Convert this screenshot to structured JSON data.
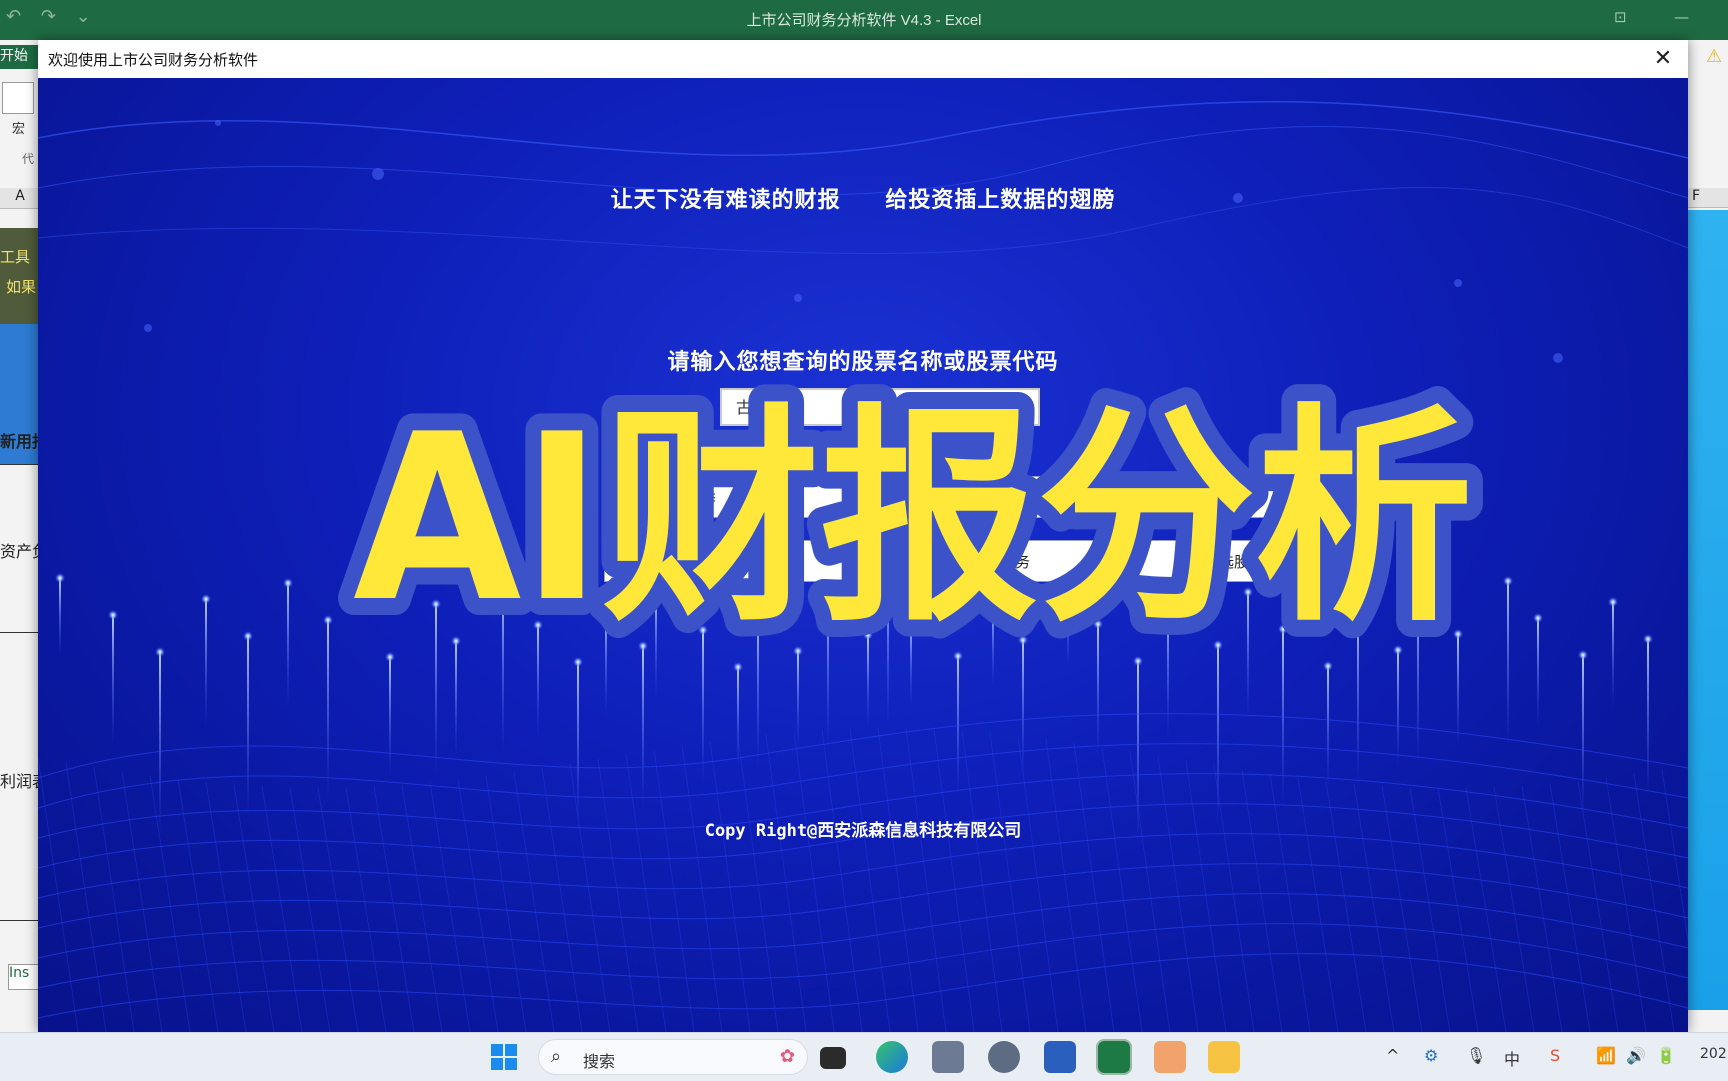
{
  "excel": {
    "window_title": "上市公司财务分析软件 V4.3 - Excel",
    "tab_start": "开始",
    "macro_label": "宏",
    "code_label": "代",
    "column_a": "A",
    "column_f": "F",
    "left_cells": [
      "工具",
      "如果",
      "新用报",
      "资产负债",
      "利润表"
    ],
    "sheet_tab": "Ins"
  },
  "dialog": {
    "title": "欢迎使用上市公司财务分析软件",
    "slogan_left": "让天下没有难读的财报",
    "slogan_right": "给投资插上数据的翅膀",
    "prompt": "请输入您想查询的股票名称或股票代码",
    "stock_input_value": "古井贡酒",
    "button_row_1": [
      "季",
      "分"
    ],
    "button_row_2": [
      "业",
      "务",
      "购",
      "选股"
    ],
    "banner_text": "AI财报分析",
    "copyright": "Copy Right@西安派森信息科技有限公司"
  },
  "taskbar": {
    "search_placeholder": "搜索",
    "clock_partial": "202"
  },
  "colors": {
    "excel_green": "#1e6b43",
    "dialog_blue": "#0e1fb8",
    "banner_yellow": "#ffe83a",
    "banner_outline": "#3c52c8"
  }
}
